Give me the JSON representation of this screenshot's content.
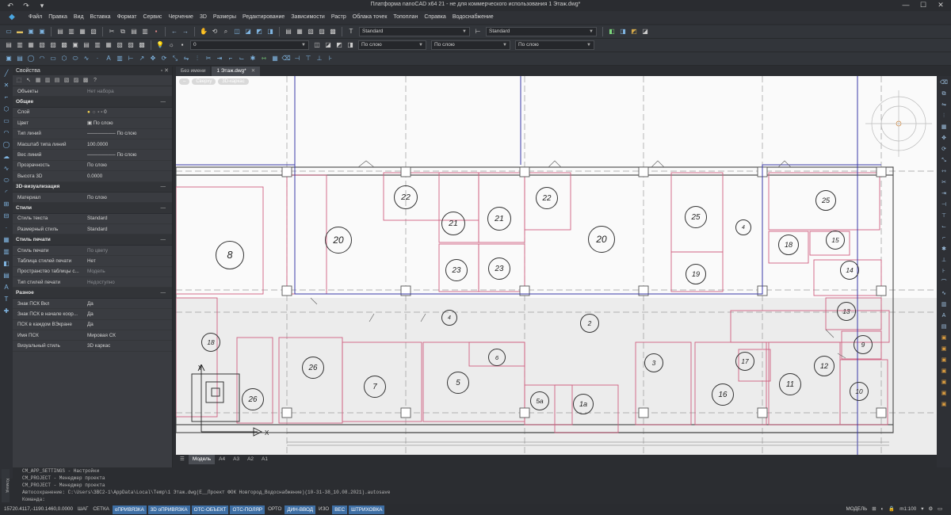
{
  "window": {
    "title": "Платформа nanoCAD x64 21 - не для коммерческого использования 1 Этаж.dwg*",
    "min": "—",
    "max": "☐",
    "close": "✕"
  },
  "menu": [
    "Файл",
    "Правка",
    "Вид",
    "Вставка",
    "Формат",
    "Сервис",
    "Черчение",
    "3D",
    "Размеры",
    "Редактирование",
    "Зависимости",
    "Растр",
    "Облака точек",
    "Топоплан",
    "Справка",
    "Водоснабжение"
  ],
  "toolbar": {
    "text_style": "Standard",
    "dim_style": "Standard",
    "layer": "0",
    "color": "По слою",
    "linetype": "По слою",
    "lineweight": "По слою"
  },
  "properties": {
    "title": "Свойства",
    "objects_label": "Объекты",
    "objects_value": "Нет набора",
    "sections": [
      {
        "name": "Общие",
        "rows": [
          {
            "k": "Слой",
            "v": "0"
          },
          {
            "k": "Цвет",
            "v": "По слою"
          },
          {
            "k": "Тип линий",
            "v": "По слою"
          },
          {
            "k": "Масштаб типа линий",
            "v": "100.0000"
          },
          {
            "k": "Вес линий",
            "v": "По слою"
          },
          {
            "k": "Прозрачность",
            "v": "По слою"
          },
          {
            "k": "Высота 3D",
            "v": "0.0000"
          }
        ]
      },
      {
        "name": "3D-визуализация",
        "rows": [
          {
            "k": "Материал",
            "v": "По слою"
          }
        ]
      },
      {
        "name": "Стили",
        "rows": [
          {
            "k": "Стиль текста",
            "v": "Standard"
          },
          {
            "k": "Размерный стиль",
            "v": "Standard"
          }
        ]
      },
      {
        "name": "Стиль печати",
        "rows": [
          {
            "k": "Стиль печати",
            "v": "По цвету",
            "dim": true
          },
          {
            "k": "Таблица стилей печати",
            "v": "Нет"
          },
          {
            "k": "Пространство таблицы с...",
            "v": "Модель",
            "dim": true
          },
          {
            "k": "Тип стилей печати",
            "v": "Недоступно",
            "dim": true
          }
        ]
      },
      {
        "name": "Разное",
        "rows": [
          {
            "k": "Знак ПСК Вкл",
            "v": "Да"
          },
          {
            "k": "Знак ПСК в начале коор...",
            "v": "Да"
          },
          {
            "k": "ПСК в каждом ВЭкране",
            "v": "Да"
          },
          {
            "k": "Имя ПСК",
            "v": "Мировая СК"
          },
          {
            "k": "Визуальный стиль",
            "v": "3D каркас"
          }
        ]
      }
    ]
  },
  "doc_tabs": [
    {
      "label": "Без имени",
      "active": false
    },
    {
      "label": "1 Этаж.dwg*",
      "active": true
    }
  ],
  "view_tabs": [
    "Сверху",
    "3D-каркас"
  ],
  "layout_tabs": [
    "Модель",
    "A4",
    "A3",
    "A2",
    "A1"
  ],
  "rooms": [
    {
      "label": "8"
    },
    {
      "label": "20"
    },
    {
      "label": "22"
    },
    {
      "label": "21"
    },
    {
      "label": "21"
    },
    {
      "label": "22"
    },
    {
      "label": "20"
    },
    {
      "label": "25"
    },
    {
      "label": "4"
    },
    {
      "label": "25"
    },
    {
      "label": "23"
    },
    {
      "label": "23"
    },
    {
      "label": "19"
    },
    {
      "label": "18"
    },
    {
      "label": "15"
    },
    {
      "label": "14"
    },
    {
      "label": "4"
    },
    {
      "label": "2"
    },
    {
      "label": "13"
    },
    {
      "label": "18"
    },
    {
      "label": "26"
    },
    {
      "label": "6"
    },
    {
      "label": "3"
    },
    {
      "label": "17"
    },
    {
      "label": "9"
    },
    {
      "label": "7"
    },
    {
      "label": "5"
    },
    {
      "label": "12"
    },
    {
      "label": "11"
    },
    {
      "label": "16"
    },
    {
      "label": "10"
    },
    {
      "label": "26"
    },
    {
      "label": "5а"
    },
    {
      "label": "1а"
    }
  ],
  "command_lines": [
    "CM_APP_SETTINGS - Настройки",
    "CM_PROJECT - Менеджер проекта",
    "CM_PROJECT - Менеджер проекта",
    "Автосохранение: C:\\Users\\ЗВС2-1\\AppData\\Local\\Temp\\1 Этаж.dwg(E__Проект ФОК Новгород_Водоснабжение)(10-31-38_10.08.2021).autosave",
    "Команда:"
  ],
  "command_side_label": "Команд",
  "status": {
    "coords": "15720.4117,-1190.1460,0.0000",
    "toggles": [
      {
        "label": "ШАГ",
        "on": false
      },
      {
        "label": "СЕТКА",
        "on": false
      },
      {
        "label": "оПРИВЯЗКА",
        "on": true
      },
      {
        "label": "3D оПРИВЯЗКА",
        "on": true
      },
      {
        "label": "ОТС-ОБЪЕКТ",
        "on": true
      },
      {
        "label": "ОТС-ПОЛЯР",
        "on": true
      },
      {
        "label": "ОРТО",
        "on": false
      },
      {
        "label": "ДИН-ВВОД",
        "on": true
      },
      {
        "label": "ИЗО",
        "on": false
      },
      {
        "label": "ВЕС",
        "on": true
      },
      {
        "label": "ШТРИХОВКА",
        "on": true
      }
    ],
    "model": "МОДЕЛЬ",
    "scale": "m1:100"
  }
}
